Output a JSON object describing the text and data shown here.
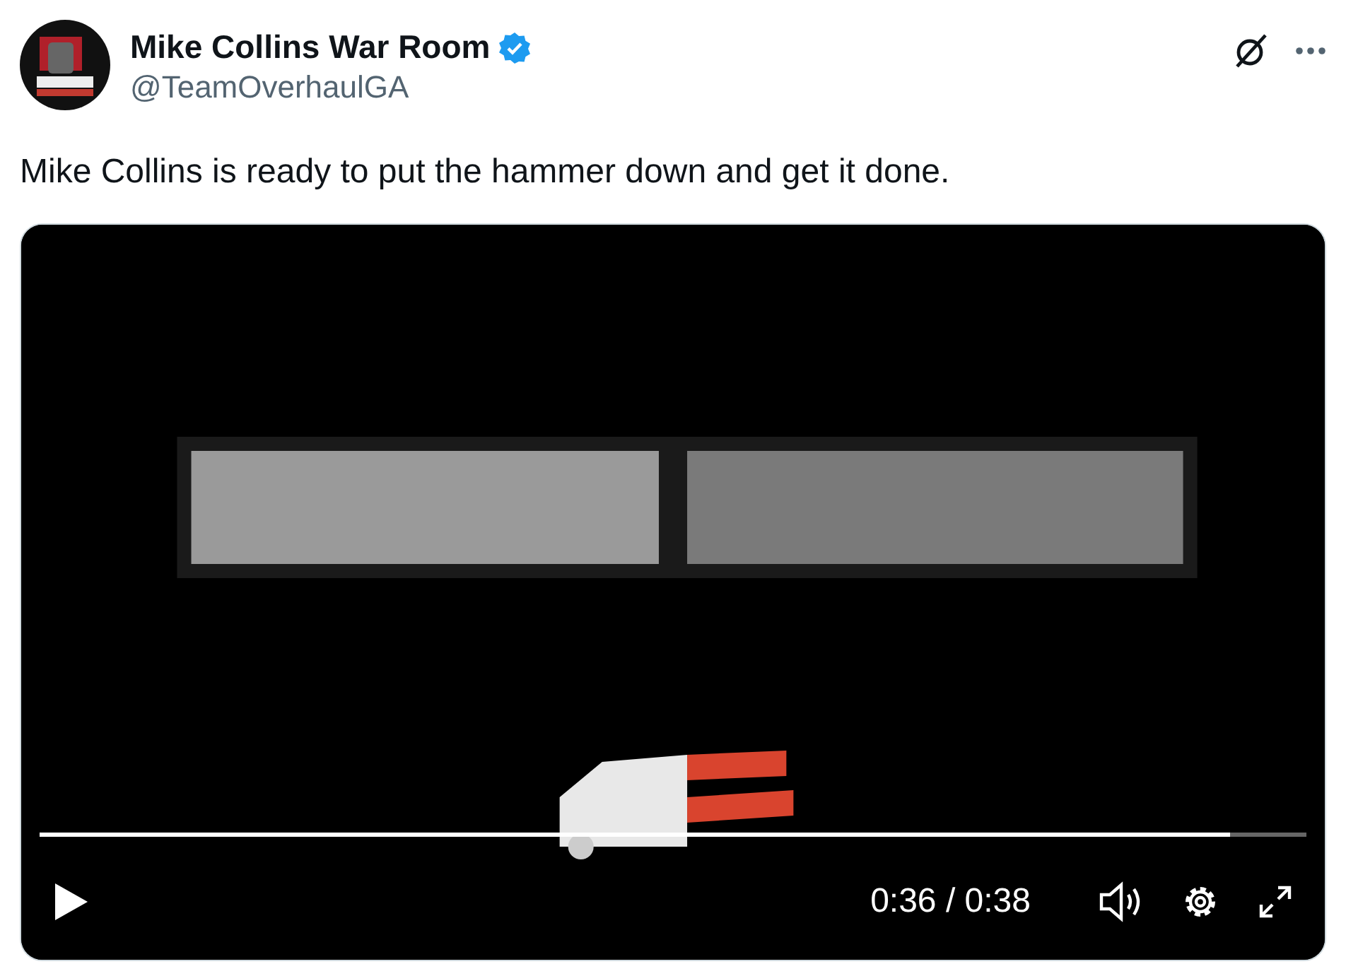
{
  "author": {
    "name": "Mike Collins War Room",
    "verified": true,
    "handle": "@TeamOverhaulGA"
  },
  "text": "Mike Collins is ready to put the hammer down and get it done.",
  "video": {
    "kind": "picture",
    "progress": {
      "level": 0.94
    },
    "time": "0:36 / 0:38"
  }
}
